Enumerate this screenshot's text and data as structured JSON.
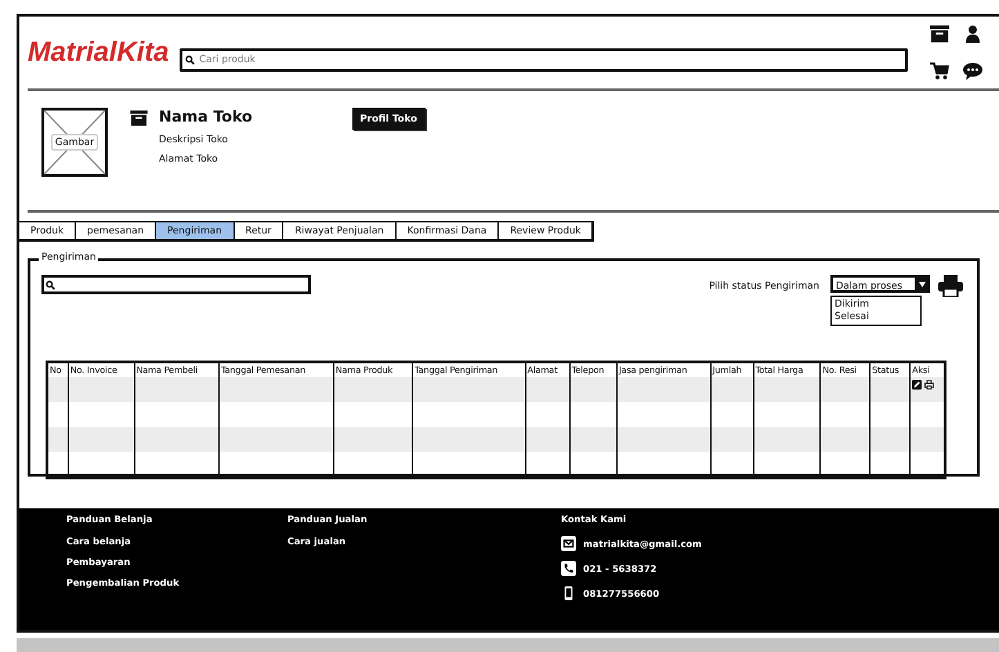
{
  "header": {
    "logo": "MatrialKita",
    "search": {
      "placeholder": "Cari produk"
    }
  },
  "store": {
    "image_label": "Gambar",
    "name": "Nama Toko",
    "description": "Deskripsi Toko",
    "address": "Alamat Toko",
    "profile_button": "Profil Toko"
  },
  "tabs": [
    {
      "label": "Produk",
      "selected": false
    },
    {
      "label": "pemesanan",
      "selected": false
    },
    {
      "label": "Pengiriman",
      "selected": true
    },
    {
      "label": "Retur",
      "selected": false
    },
    {
      "label": "Riwayat Penjualan",
      "selected": false
    },
    {
      "label": "Konfirmasi Dana",
      "selected": false
    },
    {
      "label": "Review Produk",
      "selected": false
    }
  ],
  "panel": {
    "title": "Pengiriman",
    "status_label": "Pilih status Pengiriman",
    "status_dropdown": {
      "value": "Dalam proses",
      "expanded": true,
      "options": [
        "Dikirim",
        "Selesai"
      ]
    }
  },
  "table": {
    "columns": [
      "No",
      "No. Invoice",
      "Nama Pembeli",
      "Tanggal Pemesanan",
      "Nama Produk",
      "Tanggal Pengiriman",
      "Alamat",
      "Telepon",
      "Jasa pengiriman",
      "Jumlah",
      "Total Harga",
      "No. Resi",
      "Status",
      "Aksi"
    ],
    "rows": [
      {
        "actions": true
      },
      {
        "actions": false
      },
      {
        "actions": false
      },
      {
        "actions": false
      }
    ]
  },
  "footer": {
    "columns": [
      {
        "title": "Panduan Belanja",
        "links": [
          "Cara belanja",
          "Pembayaran",
          "Pengembalian Produk"
        ]
      },
      {
        "title": "Panduan Jualan",
        "links": [
          "Cara jualan"
        ]
      }
    ],
    "contact": {
      "title": "Kontak Kami",
      "items": [
        {
          "kind": "email",
          "text": "matrialkita@gmail.com"
        },
        {
          "kind": "phone",
          "text": "021 - 5638372"
        },
        {
          "kind": "mobile",
          "text": "081277556600"
        }
      ]
    }
  }
}
